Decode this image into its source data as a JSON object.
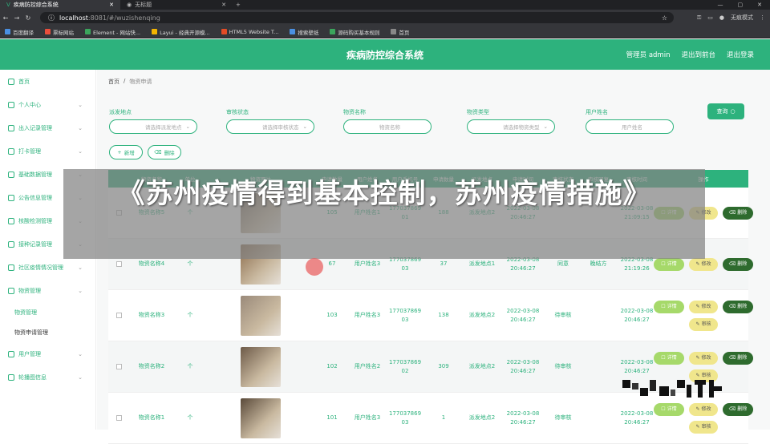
{
  "browser": {
    "active_tab": "疾病防控综合系统",
    "inactive_tab": "无标题",
    "url_host": "localhost",
    "url_rest": ":8081/#/wuzishenqing",
    "profile_label": "无痕模式",
    "bookmarks": [
      "百度翻译",
      "票标网站",
      "Element - 网站快...",
      "Layui - 经典开源模...",
      "HTML5 Website T...",
      "搜索壁纸",
      "源码购买基本规则",
      "首页"
    ]
  },
  "header": {
    "title": "疾病防控综合系统",
    "links": [
      "管理员 admin",
      "退出到前台",
      "退出登录"
    ]
  },
  "sidebar": {
    "items": [
      {
        "label": "首页",
        "chev": false
      },
      {
        "label": "个人中心",
        "chev": true
      },
      {
        "label": "出入记录管理",
        "chev": true
      },
      {
        "label": "打卡管理",
        "chev": true
      },
      {
        "label": "基础数据管理",
        "chev": true
      },
      {
        "label": "公告信息管理",
        "chev": true
      },
      {
        "label": "核酸检测管理",
        "chev": true
      },
      {
        "label": "接种记录管理",
        "chev": true
      },
      {
        "label": "社区疫情情况管理",
        "chev": true
      },
      {
        "label": "物资管理",
        "chev": true
      }
    ],
    "sub_items": [
      "物资管理",
      "物资申请管理"
    ],
    "items_after": [
      {
        "label": "用户管理",
        "chev": true
      },
      {
        "label": "轮播图信息",
        "chev": true
      }
    ]
  },
  "breadcrumb": {
    "home": "首页",
    "sep": "/",
    "current": "物资申请"
  },
  "filters": [
    {
      "label": "派发地点",
      "placeholder": "请选择派发地点",
      "suffix": "⌄"
    },
    {
      "label": "审核状态",
      "placeholder": "请选择审核状态",
      "suffix": "⌄"
    },
    {
      "label": "物资名称",
      "placeholder": "物资名称",
      "suffix": ""
    },
    {
      "label": "物资类型",
      "placeholder": "请选择物资类型",
      "suffix": "⌄"
    },
    {
      "label": "用户姓名",
      "placeholder": "用户姓名",
      "suffix": ""
    }
  ],
  "buttons": {
    "search": "查询",
    "add": "新增",
    "delete": "删除"
  },
  "table": {
    "columns": [
      "",
      "物资名称",
      "单位",
      "物资照片",
      "申请数量",
      "用户姓名",
      "用户手机号",
      "申请数量",
      "派发地点",
      "申请时间",
      "审核状态",
      "审核回复",
      "审核时间",
      "操作"
    ],
    "rows": [
      {
        "name": "物资名称5",
        "unit": "个",
        "qty": "105",
        "user": "用户姓名1",
        "phone": "17703786901",
        "amount": "188",
        "place": "派发地点2",
        "time": "2022-03-08 20:46:27",
        "status": "",
        "reply": "",
        "audit_time": "2022-03-08 21:09:15",
        "img": "#7a6a5a"
      },
      {
        "name": "物资名称4",
        "unit": "个",
        "qty": "67",
        "user": "用户姓名3",
        "phone": "17703786903",
        "amount": "37",
        "place": "派发地点1",
        "time": "2022-03-08 20:46:27",
        "status": "同意",
        "reply": "晚结方",
        "audit_time": "2022-03-08 21:19:26",
        "img": "#8b6b4b"
      },
      {
        "name": "物资名称3",
        "unit": "个",
        "qty": "103",
        "user": "用户姓名3",
        "phone": "17703786903",
        "amount": "138",
        "place": "派发地点2",
        "time": "2022-03-08 20:46:27",
        "status": "待审核",
        "reply": "",
        "audit_time": "2022-03-08 20:46:27",
        "img": "#9a8a7a"
      },
      {
        "name": "物资名称2",
        "unit": "个",
        "qty": "102",
        "user": "用户姓名2",
        "phone": "17703786902",
        "amount": "309",
        "place": "派发地点2",
        "time": "2022-03-08 20:46:27",
        "status": "待审核",
        "reply": "",
        "audit_time": "2022-03-08 20:46:27",
        "img": "#6d5a48"
      },
      {
        "name": "物资名称1",
        "unit": "个",
        "qty": "101",
        "user": "用户姓名3",
        "phone": "17703786903",
        "amount": "1",
        "place": "派发地点2",
        "time": "2022-03-08 20:46:27",
        "status": "待审核",
        "reply": "",
        "audit_time": "2022-03-08 20:46:27",
        "img": "#5a4a3a"
      }
    ],
    "ops": {
      "review": "详情",
      "edit": "修改",
      "delete": "删除",
      "audit": "审核"
    }
  },
  "overlay": {
    "headline": "《苏州疫情得到基本控制，苏州疫情措施》"
  },
  "colors": {
    "accent": "#2db27d",
    "overlay": "#828282"
  }
}
